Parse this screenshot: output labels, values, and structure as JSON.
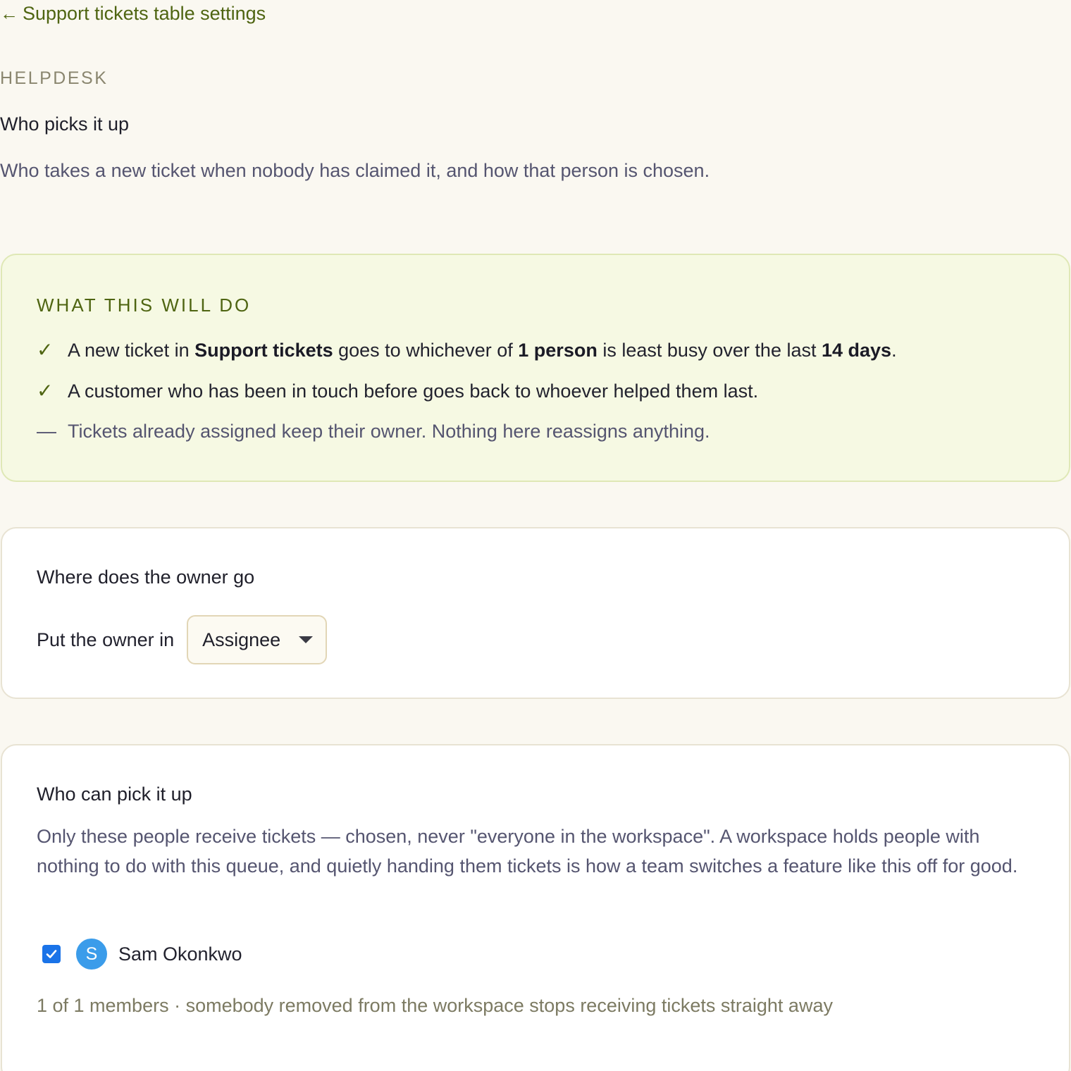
{
  "nav": {
    "back_arrow": "←",
    "back_label": "Support tickets table settings"
  },
  "header": {
    "eyebrow": "HELPDESK",
    "title": "Who picks it up",
    "subtitle": "Who takes a new ticket when nobody has claimed it, and how that person is chosen."
  },
  "summary": {
    "eyebrow": "WHAT THIS WILL DO",
    "items": [
      {
        "mark": "✓",
        "parts": [
          "A new ticket in ",
          "Support tickets",
          " goes to whichever of ",
          "1 person",
          " is least busy over the last ",
          "14 days",
          "."
        ]
      },
      {
        "mark": "✓",
        "text": "A customer who has been in touch before goes back to whoever helped them last."
      },
      {
        "mark": "—",
        "text": "Tickets already assigned keep their owner. Nothing here reassigns anything."
      }
    ]
  },
  "owner": {
    "title": "Where does the owner go",
    "label": "Put the owner in",
    "selected": "Assignee"
  },
  "picker": {
    "title": "Who can pick it up",
    "description": "Only these people receive tickets — chosen, never \"everyone in the workspace\". A workspace holds people with nothing to do with this queue, and quietly handing them tickets is how a team switches a feature like this off for good.",
    "members": [
      {
        "initial": "S",
        "name": "Sam Okonkwo",
        "checked": true,
        "avatar_color": "#3b9cea"
      }
    ],
    "count_text": "1 of 1 members · somebody removed from the workspace stops receiving tickets straight away"
  },
  "colors": {
    "accent": "#4f6512",
    "background": "#faf8f1",
    "summary_bg": "#f6f9e3",
    "checkbox": "#1a73e8"
  }
}
